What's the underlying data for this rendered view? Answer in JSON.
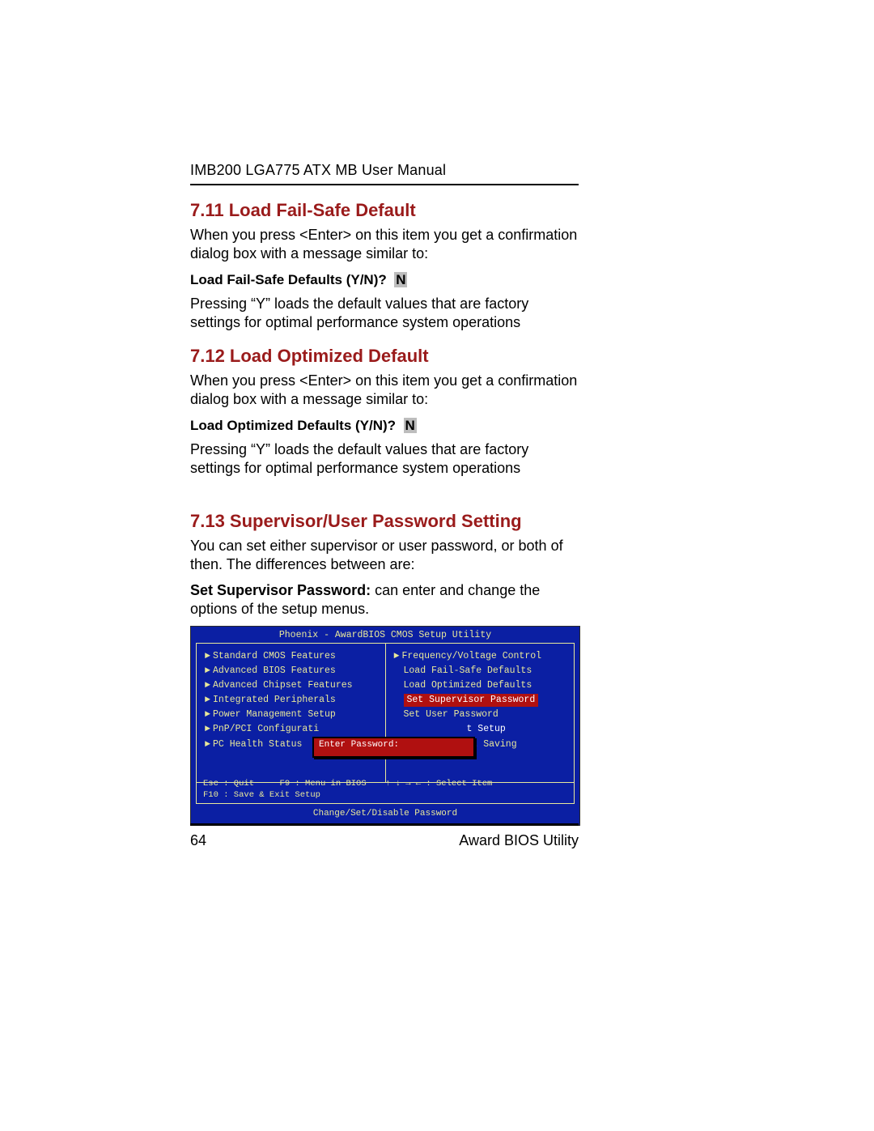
{
  "header": {
    "running_head": "IMB200 LGA775 ATX MB User Manual"
  },
  "sections": {
    "s711": {
      "title": "7.11 Load Fail-Safe Default",
      "p1": "When you press <Enter> on this item you get a confirmation dialog box with a message similar to:",
      "prompt_label": "Load Fail-Safe Defaults (Y/N)?",
      "prompt_default": "N",
      "p2": "Pressing “Y” loads the default values that are factory settings for optimal performance system operations"
    },
    "s712": {
      "title": "7.12 Load Optimized Default",
      "p1": "When you press <Enter> on this item you get a confirmation dialog box with a message similar to:",
      "prompt_label": "Load Optimized Defaults (Y/N)?",
      "prompt_default": "N",
      "p2": "Pressing “Y” loads the default values that are factory settings for optimal performance system operations"
    },
    "s713": {
      "title": "7.13 Supervisor/User Password Setting",
      "p1": "You can set either supervisor or user password, or both of then. The differences between are:",
      "p2_bold": "Set Supervisor Password:",
      "p2_rest": " can enter and change the options of the setup menus."
    }
  },
  "bios": {
    "title": "Phoenix - AwardBIOS CMOS Setup Utility",
    "left_items": [
      "Standard CMOS Features",
      "Advanced BIOS Features",
      "Advanced Chipset Features",
      "Integrated Peripherals",
      "Power Management Setup",
      "PnP/PCI Configurati",
      "PC Health Status"
    ],
    "right_items": {
      "r0": "Frequency/Voltage Control",
      "r1": "Load Fail-Safe Defaults",
      "r2": "Load Optimized Defaults",
      "r3_selected": "Set Supervisor Password",
      "r4": "Set User Password",
      "r5_frag": "t Setup",
      "r6_frag": "ut Saving"
    },
    "popup": "Enter Password:",
    "keys": {
      "left1": "Esc : Quit",
      "left2": "F9 : Menu in BIOS",
      "left3": "F10 : Save & Exit Setup",
      "right": "↑ ↓ → ←   : Select Item"
    },
    "hint": "Change/Set/Disable Password"
  },
  "footer": {
    "page_number": "64",
    "section_title": "Award BIOS Utility"
  }
}
